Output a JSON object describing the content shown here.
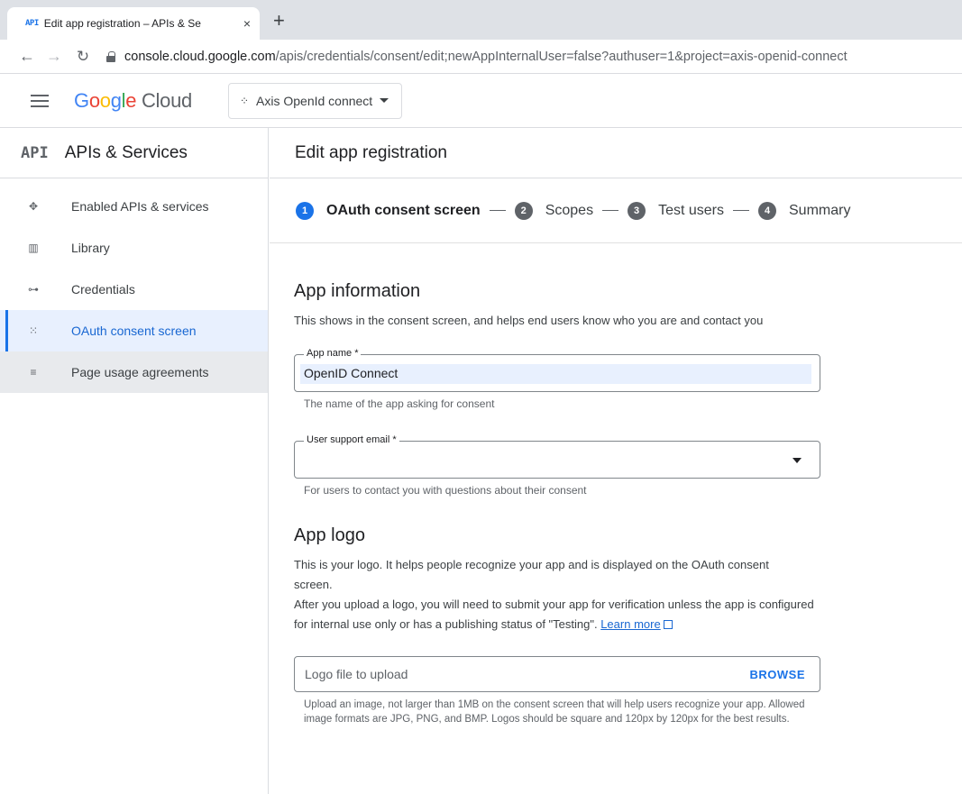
{
  "browser": {
    "tab_favicon": "API",
    "tab_title": "Edit app registration – APIs & Se",
    "tab_close": "×",
    "new_tab": "+",
    "url_host": "console.cloud.google.com",
    "url_path": "/apis/credentials/consent/edit;newAppInternalUser=false?authuser=1&project=axis-openid-connect"
  },
  "header": {
    "logo_google": [
      "G",
      "o",
      "o",
      "g",
      "l",
      "e"
    ],
    "logo_cloud": " Cloud",
    "project": "Axis OpenId connect"
  },
  "sidebar": {
    "badge": "API",
    "title": "APIs & Services",
    "items": [
      {
        "label": "Enabled APIs & services",
        "icon": "dashboard-icon",
        "state": "normal"
      },
      {
        "label": "Library",
        "icon": "library-icon",
        "state": "normal"
      },
      {
        "label": "Credentials",
        "icon": "key-icon",
        "state": "normal"
      },
      {
        "label": "OAuth consent screen",
        "icon": "consent-icon",
        "state": "active"
      },
      {
        "label": "Page usage agreements",
        "icon": "settings-list-icon",
        "state": "hover"
      }
    ]
  },
  "main": {
    "title": "Edit app registration",
    "steps": [
      {
        "num": "1",
        "label": "OAuth consent screen",
        "active": true
      },
      {
        "num": "2",
        "label": "Scopes",
        "active": false
      },
      {
        "num": "3",
        "label": "Test users",
        "active": false
      },
      {
        "num": "4",
        "label": "Summary",
        "active": false
      }
    ],
    "app_info": {
      "heading": "App information",
      "description": "This shows in the consent screen, and helps end users know who you are and contact you",
      "app_name_label": "App name *",
      "app_name_value": "OpenID Connect",
      "app_name_helper": "The name of the app asking for consent",
      "support_email_label": "User support email *",
      "support_email_value": "",
      "support_email_helper": "For users to contact you with questions about their consent"
    },
    "app_logo": {
      "heading": "App logo",
      "description1": "This is your logo. It helps people recognize your app and is displayed on the OAuth consent screen.",
      "description2": "After you upload a logo, you will need to submit your app for verification unless the app is configured for internal use only or has a publishing status of \"Testing\". ",
      "learn_more": "Learn more",
      "upload_placeholder": "Logo file to upload",
      "browse": "BROWSE",
      "upload_helper": "Upload an image, not larger than 1MB on the consent screen that will help users recognize your app. Allowed image formats are JPG, PNG, and BMP. Logos should be square and 120px by 120px for the best results."
    }
  },
  "colors": {
    "accent": "#1a73e8",
    "active_bg": "#e8f0fe",
    "hover_bg": "#e8eaed"
  }
}
